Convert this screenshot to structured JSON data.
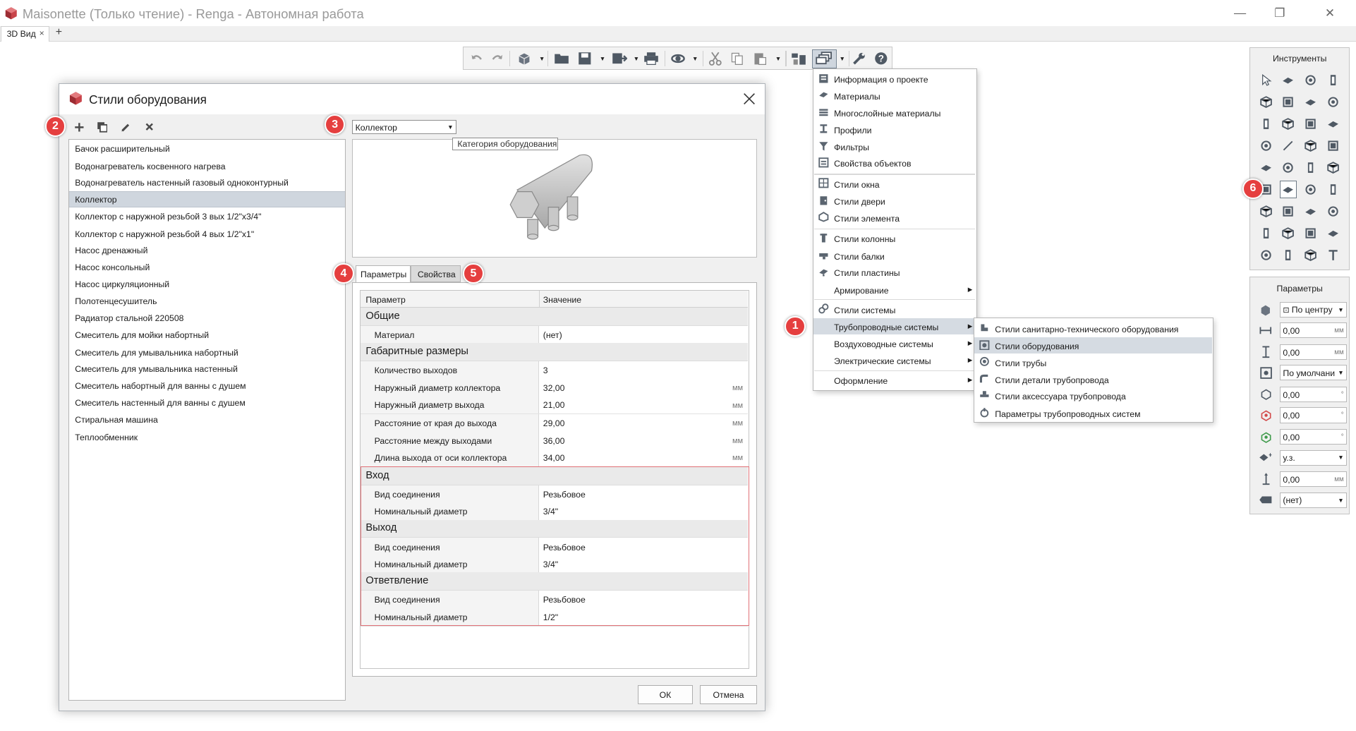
{
  "window": {
    "title": "Maisonette (Только чтение) - Renga - Автономная работа",
    "min_glyph": "—",
    "max_glyph": "❐",
    "close_glyph": "✕"
  },
  "tabs": {
    "active": "3D Вид",
    "close_glyph": "×",
    "add_glyph": "+"
  },
  "toolbar": {
    "icons": [
      "undo-icon",
      "redo-icon",
      "3d-view-icon",
      "open-folder-icon",
      "save-icon",
      "export-icon",
      "print-icon",
      "orbit-icon",
      "cut-icon",
      "copy-icon",
      "paste-icon",
      "layers-icon",
      "styles-icon",
      "settings-wrench-icon",
      "help-icon"
    ],
    "dropdown_glyph": "▼"
  },
  "dialog": {
    "title": "Стили оборудования",
    "equipment_list": [
      "Бачок расширительный",
      "Водонагреватель косвенного нагрева",
      "Водонагреватель настенный газовый одноконтурный",
      "Коллектор",
      "Коллектор с наружной резьбой 3 вых 1/2\"x3/4\"",
      "Коллектор с наружной резьбой 4 вых 1/2\"x1\"",
      "Насос дренажный",
      "Насос консольный",
      "Насос циркуляционный",
      "Полотенцесушитель",
      "Радиатор стальной 220508",
      "Смеситель для мойки набортный",
      "Смеситель для умывальника набортный",
      "Смеситель для умывальника настенный",
      "Смеситель набортный для ванны с душем",
      "Смеситель настенный для ванны с душем",
      "Стиральная машина",
      "Теплообменник"
    ],
    "selected_index": 3,
    "category": {
      "value": "Коллектор",
      "tooltip": "Категория оборудования"
    },
    "tabs": {
      "params": "Параметры",
      "props": "Свойства"
    },
    "grid": {
      "header_param": "Параметр",
      "header_value": "Значение",
      "s1": "Общие",
      "material": {
        "name": "Материал",
        "value": "(нет)"
      },
      "s2": "Габаритные размеры",
      "outlets": {
        "name": "Количество выходов",
        "value": "3"
      },
      "collector_d": {
        "name": "Наружный диаметр коллектора",
        "value": "32,00",
        "unit": "мм"
      },
      "outlet_d": {
        "name": "Наружный диаметр выхода",
        "value": "21,00",
        "unit": "мм"
      },
      "edge_dist": {
        "name": "Расстояние от края до выхода",
        "value": "29,00",
        "unit": "мм"
      },
      "between_dist": {
        "name": "Расстояние между выходами",
        "value": "36,00",
        "unit": "мм"
      },
      "outlet_len": {
        "name": "Длина выхода от оси коллектора",
        "value": "34,00",
        "unit": "мм"
      },
      "s3": "Вход",
      "in_conn": {
        "name": "Вид соединения",
        "value": "Резьбовое"
      },
      "in_dn": {
        "name": "Номинальный диаметр",
        "value": "3/4\""
      },
      "s4": "Выход",
      "out_conn": {
        "name": "Вид соединения",
        "value": "Резьбовое"
      },
      "out_dn": {
        "name": "Номинальный диаметр",
        "value": "3/4\""
      },
      "s5": "Ответвление",
      "br_conn": {
        "name": "Вид соединения",
        "value": "Резьбовое"
      },
      "br_dn": {
        "name": "Номинальный диаметр",
        "value": "1/2\""
      }
    },
    "ok": "ОК",
    "cancel": "Отмена"
  },
  "menu": [
    {
      "label": "Информация о проекте",
      "icon": "project-info-icon"
    },
    {
      "label": "Материалы",
      "icon": "materials-icon"
    },
    {
      "label": "Многослойные материалы",
      "icon": "layered-materials-icon"
    },
    {
      "label": "Профили",
      "icon": "profiles-icon"
    },
    {
      "label": "Фильтры",
      "icon": "filters-icon"
    },
    {
      "label": "Свойства объектов",
      "icon": "object-properties-icon"
    },
    {
      "label": "Стили окна",
      "icon": "window-styles-icon"
    },
    {
      "label": "Стили двери",
      "icon": "door-styles-icon"
    },
    {
      "label": "Стили элемента",
      "icon": "element-styles-icon"
    },
    {
      "label": "Стили колонны",
      "icon": "column-styles-icon"
    },
    {
      "label": "Стили балки",
      "icon": "beam-styles-icon"
    },
    {
      "label": "Стили пластины",
      "icon": "plate-styles-icon"
    },
    {
      "label": "Армирование",
      "icon": ""
    },
    {
      "label": "Стили системы",
      "icon": "system-styles-icon"
    },
    {
      "label": "Трубопроводные системы",
      "icon": ""
    },
    {
      "label": "Воздуховодные системы",
      "icon": ""
    },
    {
      "label": "Электрические системы",
      "icon": ""
    },
    {
      "label": "Оформление",
      "icon": ""
    }
  ],
  "submenu": [
    {
      "label": "Стили санитарно-технического оборудования",
      "icon": "sanitary-equipment-icon"
    },
    {
      "label": "Стили оборудования",
      "icon": "equipment-icon"
    },
    {
      "label": "Стили трубы",
      "icon": "pipe-icon"
    },
    {
      "label": "Стили детали трубопровода",
      "icon": "pipe-fitting-icon"
    },
    {
      "label": "Стили аксессуара трубопровода",
      "icon": "pipe-accessory-icon"
    },
    {
      "label": "Параметры трубопроводных систем",
      "icon": "pipe-system-params-icon"
    }
  ],
  "submenu_arrow": "▶",
  "badges": [
    "1",
    "2",
    "3",
    "4",
    "5",
    "6"
  ],
  "tools_panel": {
    "title": "Инструменты"
  },
  "params_panel": {
    "title": "Параметры",
    "anchor": "По центру",
    "x": "0,00",
    "y": "0,00",
    "align": "По умолчани",
    "rot1": "0,00",
    "rot2": "0,00",
    "rot3": "0,00",
    "level": "у.з.",
    "offset": "0,00",
    "label": "(нет)",
    "unit_mm": "мм",
    "unit_deg": "°"
  }
}
